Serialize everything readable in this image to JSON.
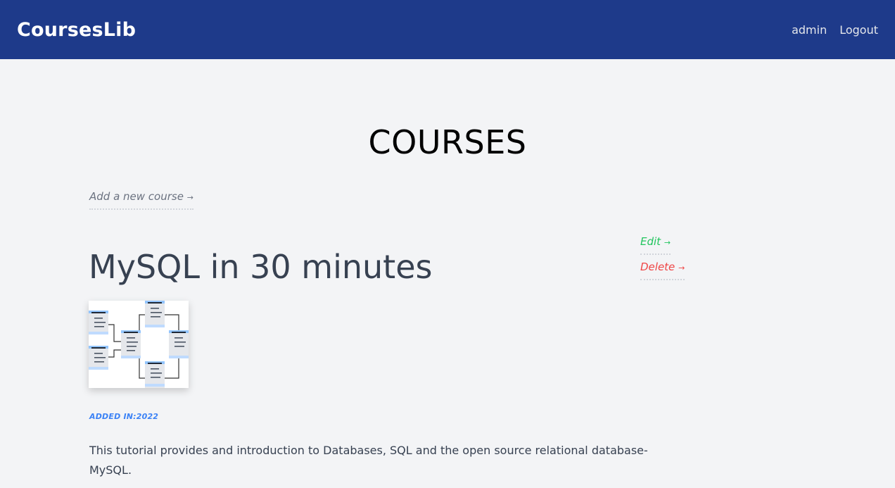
{
  "navbar": {
    "brand": "CoursesLib",
    "links": [
      "admin",
      "Logout"
    ]
  },
  "page": {
    "heading": "COURSES",
    "add_link": "Add a new course",
    "arrow": "→"
  },
  "course": {
    "title": "MySQL in 30 minutes",
    "edit_label": "Edit",
    "delete_label": "Delete",
    "added": "ADDED IN:2022",
    "description": "This tutorial provides and introduction to Databases, SQL and the open source relational database-MySQL."
  },
  "colors": {
    "navbar": "#1e3a8a",
    "edit": "#22c55e",
    "delete": "#ef4444",
    "added": "#3b82f6"
  },
  "icons": {
    "thumbnail": "database-schema-diagram-icon"
  }
}
